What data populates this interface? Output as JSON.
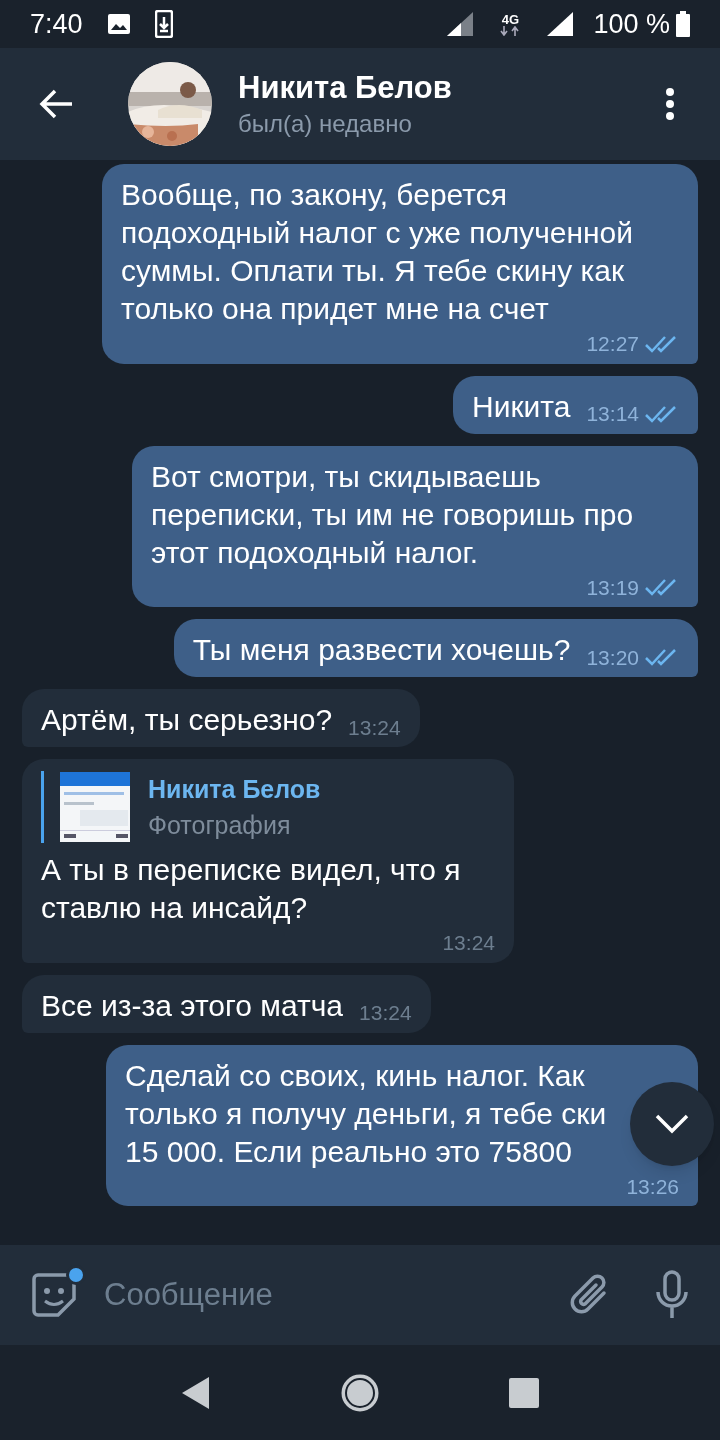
{
  "status_bar": {
    "time": "7:40",
    "network": "4G",
    "battery": "100 %"
  },
  "header": {
    "name": "Никита Белов",
    "status": "был(а) недавно"
  },
  "messages": [
    {
      "kind": "outgoing",
      "text": "Вообще, по закону, берется подоходный налог с уже полученной суммы. Оплати ты. Я тебе скину как только она придет мне на счет",
      "time": "12:27",
      "read": true
    },
    {
      "kind": "outgoing",
      "text": "Никита",
      "time": "13:14",
      "read": true
    },
    {
      "kind": "outgoing",
      "text": "Вот смотри, ты скидываешь переписки, ты им не говоришь про этот подоходный налог.",
      "time": "13:19",
      "read": true
    },
    {
      "kind": "outgoing",
      "text": "Ты меня развести хочешь?",
      "time": "13:20",
      "read": true
    },
    {
      "kind": "incoming",
      "text": "Артём, ты серьезно?",
      "time": "13:24"
    },
    {
      "kind": "incoming",
      "reply": {
        "name": "Никита Белов",
        "caption": "Фотография"
      },
      "text": "А ты в переписке видел, что я ставлю на инсайд?",
      "time": "13:24"
    },
    {
      "kind": "incoming",
      "text": "Все из-за этого матча",
      "time": "13:24"
    },
    {
      "kind": "outgoing",
      "text": "Сделай со своих, кинь налог. Как только я получу деньги, я тебе ски 15 000. Если реально это 75800",
      "time": "13:26",
      "read": false
    }
  ],
  "composer": {
    "placeholder": "Сообщение",
    "sticker_badge": true
  }
}
